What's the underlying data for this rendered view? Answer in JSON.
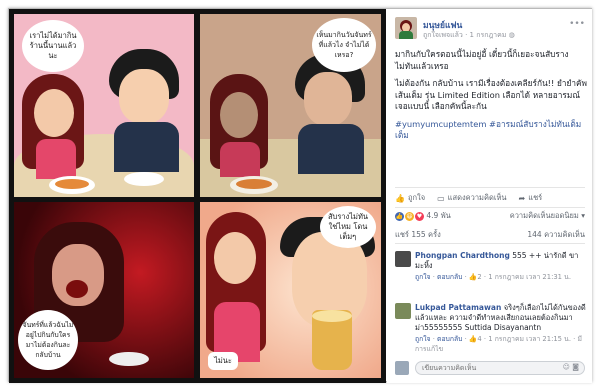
{
  "post": {
    "page_name": "มนุษย์แฟน",
    "like_label": "ถูกใจเพจแล้ว",
    "date": "1 กรกฎาคม",
    "paragraphs": [
      "มากินกับใครตอนนี้ไม่อยู่อี้ เดี๋ยวนี้ก็เยอะจนสับรางไม่ทันแล้วเหรอ",
      "ไม่ต้องกัน กลับบ้าน เรามีเรื่องต้องเคลียร์กัน!! ยำยำคัพเส้นเต็ม รุ่น Limited Edition เลือกได้ หลายอารมณ์ เจอแบบนี้ เลือกคัพนี้ละกัน"
    ],
    "hashtags": "#yumyumcuptemtem #อารมณ์สับรางไม่ทันเต็มเต็ม"
  },
  "actions": {
    "like": "ถูกใจ",
    "comment": "แสดงความคิดเห็น",
    "share": "แชร์"
  },
  "reactions": {
    "count": "4.9 พัน",
    "sort_label": "ความคิดเห็นยอดนิยม"
  },
  "stats": {
    "shares": "แชร์ 155 ครั้ง",
    "comments": "144 ความคิดเห็น"
  },
  "comments": [
    {
      "name": "Phongpan Chardthong",
      "text": "555 ++ น่ารักดี ขามะหิ้ง",
      "like": "ถูกใจ",
      "reply": "ตอบกลับ",
      "likes": "2",
      "time": "1 กรกฎาคม เวลา 21:31 น."
    },
    {
      "name": "Lukpad Pattamawan",
      "text": "จริงๆก็เลือกไม่ได้กันของดีแล้วแหละ ความจำดีทำหลงเสียกอนเลยต้องกินมาม่า55555555 Suttida Disayanantn",
      "like": "ถูกใจ",
      "reply": "ตอบกลับ",
      "likes": "4",
      "time": "1 กรกฎาคม เวลา 21:15 น.",
      "edited": "มีการแก้ไข"
    }
  ],
  "reply_placeholder": "เขียนความคิดเห็น",
  "comic": {
    "bubble1": "เราไม่ได้มากินร้านนี้นานแล้วนะ",
    "bubble2": "เห็นมากินวันจันทร์ที่แล้วไง จำไม่ได้เหรอ?",
    "bubble3": "สับรางไม่ทันใช่ไหม โดนเต็มๆ",
    "bubble4": "จันทร์ที่แล้วฉันไม่อยู่ไปกินกับใครมาไม่ต้องกินละ กลับบ้าน",
    "bubble5": "ไม่นะ"
  },
  "colors": {
    "link": "#365899",
    "meta": "#90949c",
    "accent": "#4267b2"
  }
}
